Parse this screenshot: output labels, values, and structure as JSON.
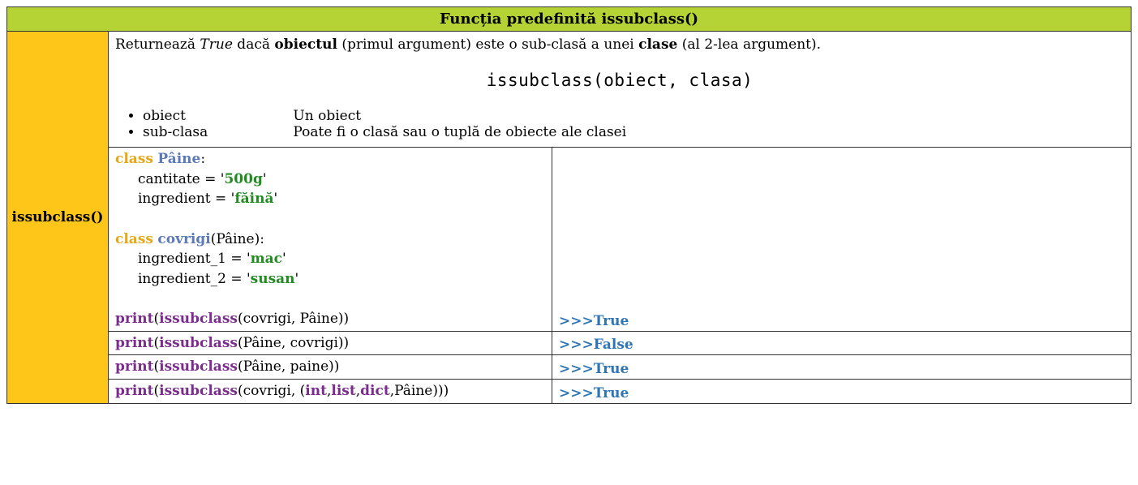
{
  "header": {
    "title": "Funcția predefinită issubclass()"
  },
  "side_label": "issubclass()",
  "description": {
    "prefix": "Returnează ",
    "true_word": "True",
    "mid1": " dacă ",
    "bold_obj": "obiectul",
    "mid2": " (primul argument) este o sub-clasă a unei ",
    "bold_cls": "clase",
    "suffix": " (al 2-lea argument).",
    "signature": "issubclass(obiect, clasa)",
    "params": [
      {
        "name": "obiect",
        "desc": "Un obiect"
      },
      {
        "name": "sub-clasa",
        "desc": "Poate fi o clasă sau o tuplă de obiecte ale clasei"
      }
    ]
  },
  "code": {
    "kw_class": "class",
    "cls_paine": "Pâine",
    "cls_covrigi": "covrigi",
    "colon": ":",
    "lparen": "(",
    "rparen": ")",
    "attr_cantitate": "cantitate = '",
    "val_500g": "500g",
    "close_q": "'",
    "attr_ingredient": "ingredient = '",
    "val_faina": "făină",
    "attr_ing1": "ingredient_1 = '",
    "val_mac": "mac",
    "attr_ing2": "ingredient_2 = '",
    "val_susan": "susan",
    "print": "print",
    "issubclass": "issubclass",
    "args1": "(covrigi, Pâine))",
    "args2": "(Pâine, covrigi))",
    "args3": "(Pâine, paine))",
    "args4_open": "(covrigi, (",
    "t_int": "int",
    "comma": ",",
    "t_list": "list",
    "t_dict": "dict",
    "args4_close": ",Pâine)))"
  },
  "output": {
    "prompt": ">>>",
    "true": "True",
    "false": "False"
  }
}
